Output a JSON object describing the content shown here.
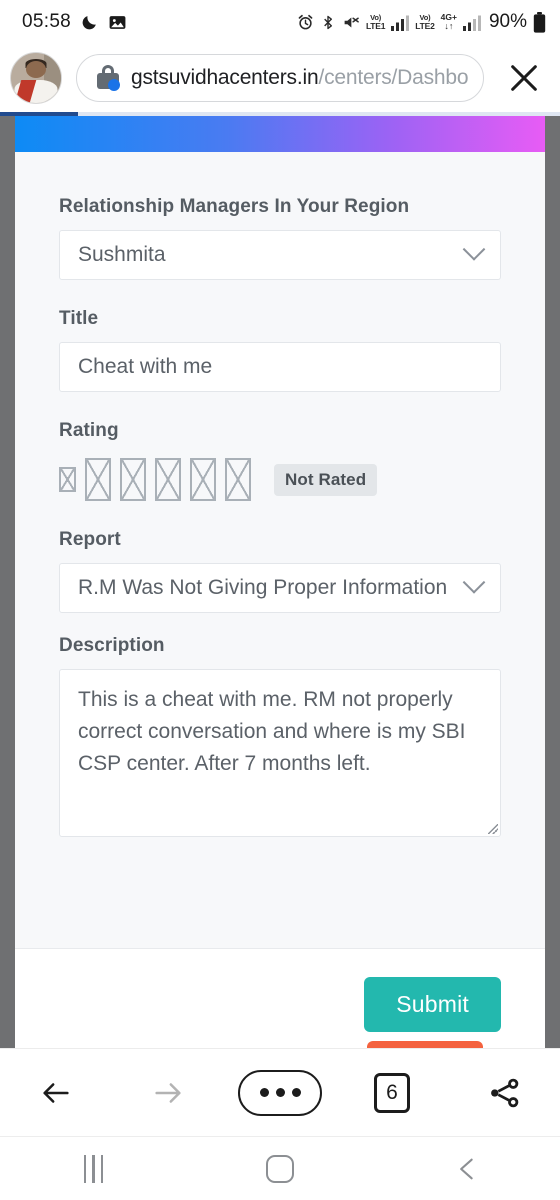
{
  "status_bar": {
    "time": "05:58",
    "icons_left": [
      "moon-icon",
      "image-icon"
    ],
    "icons_right": [
      "alarm-icon",
      "bluetooth-icon",
      "mute-icon",
      "volte1-icon",
      "signal-bars-icon",
      "volte2-icon",
      "fourg-plus-icon",
      "signal-bars-icon",
      "battery-icon"
    ],
    "volte1_top": "Vo)",
    "volte1_bottom": "LTE1",
    "volte2_top": "Vo)",
    "volte2_bottom": "LTE2",
    "fourg_label": "4G+",
    "fourg_arrows": "↓↑",
    "battery_percent": "90%"
  },
  "browser": {
    "url_domain": "gstsuvidhacenters.in",
    "url_path": "/centers/Dashbo",
    "lock_icon": "lock-icon",
    "close_icon": "close-icon",
    "avatar": "user-avatar",
    "toolbar": {
      "back_label": "←",
      "forward_label": "→",
      "tab_count": "6",
      "menu_icon": "three-dots-icon",
      "share_icon": "share-icon"
    }
  },
  "android_nav": {
    "recents_icon": "recents-icon",
    "home_icon": "home-icon",
    "back_icon": "back-chevron-icon"
  },
  "form": {
    "rm_label": "Relationship Managers In Your Region",
    "rm_value": "Sushmita",
    "title_label": "Title",
    "title_value": "Cheat with me",
    "rating_label": "Rating",
    "rating_badge": "Not Rated",
    "rating_stars": 5,
    "report_label": "Report",
    "report_value": "R.M Was Not Giving Proper Information",
    "description_label": "Description",
    "description_value": "This is a cheat with me. RM not properly correct conversation and where is my SBI CSP center. After 7 months left.",
    "submit_label": "Submit"
  },
  "colors": {
    "gradient_start": "#0d8bf5",
    "gradient_end": "#e85cf5",
    "submit_bg": "#23b8ae",
    "secondary_btn": "#f4623f",
    "badge_bg": "#e3e6e9",
    "progress_fill": "#214b8f"
  }
}
